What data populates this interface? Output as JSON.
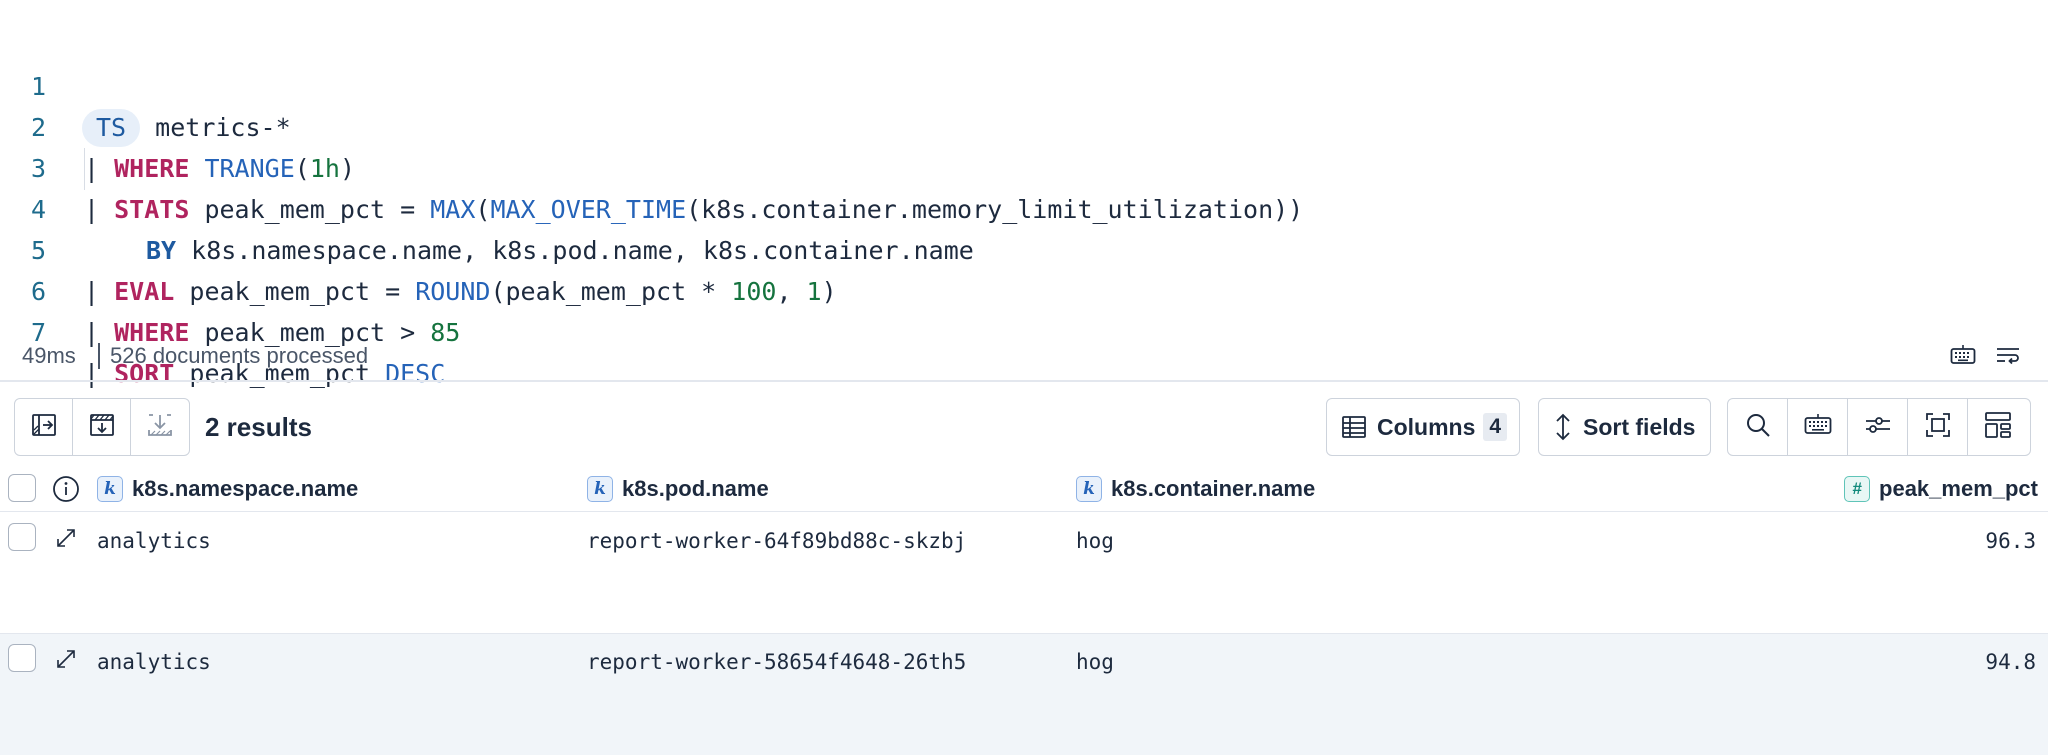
{
  "editor": {
    "line_numbers": [
      "1",
      "2",
      "3",
      "4",
      "5",
      "6",
      "7"
    ],
    "line1": {
      "cmd": "TS",
      "index": "metrics-*"
    },
    "line2": {
      "pipe": "|",
      "kw": "WHERE",
      "fn": "TRANGE",
      "open": "(",
      "arg": "1h",
      "close": ")"
    },
    "line3": {
      "pipe": "|",
      "kw": "STATS",
      "field": "peak_mem_pct = ",
      "fn1": "MAX",
      "open1": "(",
      "fn2": "MAX_OVER_TIME",
      "rest": "(k8s.container.memory_limit_utilization))"
    },
    "line4": {
      "kw": "BY",
      "rest": "k8s.namespace.name, k8s.pod.name, k8s.container.name"
    },
    "line5": {
      "pipe": "|",
      "kw": "EVAL",
      "field": "peak_mem_pct = ",
      "fn": "ROUND",
      "mid": "(peak_mem_pct * ",
      "n1": "100",
      "comma": ", ",
      "n2": "1",
      "close": ")"
    },
    "line6": {
      "pipe": "|",
      "kw": "WHERE",
      "field": "peak_mem_pct > ",
      "n": "85"
    },
    "line7": {
      "pipe": "|",
      "kw": "SORT",
      "field": "peak_mem_pct ",
      "dir": "DESC"
    }
  },
  "status": {
    "time": "49ms",
    "documents": "526 documents processed",
    "icons": [
      "keyboard-icon",
      "wrap-lines-icon"
    ]
  },
  "toolbar": {
    "left_buttons": [
      "toggle-sidebar-icon",
      "expand-rows-icon",
      "download-icon"
    ],
    "results": "2 results",
    "columns_label": "Columns",
    "columns_count": "4",
    "sort_label": "Sort fields",
    "right_buttons": [
      "search-icon",
      "keyboard-icon",
      "display-settings-icon",
      "fullscreen-icon",
      "layout-icon"
    ]
  },
  "grid": {
    "columns": [
      {
        "type": "k",
        "name": "k8s.namespace.name"
      },
      {
        "type": "k",
        "name": "k8s.pod.name"
      },
      {
        "type": "k",
        "name": "k8s.container.name"
      },
      {
        "type": "#",
        "name": "peak_mem_pct"
      }
    ],
    "rows": [
      {
        "namespace": "analytics",
        "pod": "report-worker-64f89bd88c-skzbj",
        "container": "hog",
        "peak": "96.3"
      },
      {
        "namespace": "analytics",
        "pod": "report-worker-58654f4648-26th5",
        "container": "hog",
        "peak": "94.8"
      }
    ]
  },
  "colors": {
    "keyword": "#b0245f",
    "function": "#2563b8",
    "number": "#15733e",
    "line_number": "#1e6b8c"
  }
}
